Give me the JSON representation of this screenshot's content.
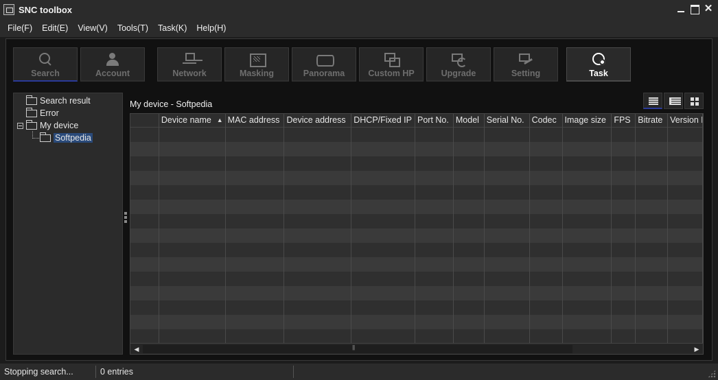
{
  "window": {
    "title": "SNC toolbox"
  },
  "menu": [
    "File(F)",
    "Edit(E)",
    "View(V)",
    "Tools(T)",
    "Task(K)",
    "Help(H)"
  ],
  "toolbar": {
    "search": "Search",
    "account": "Account",
    "network": "Network",
    "masking": "Masking",
    "panorama": "Panorama",
    "custom_hp": "Custom HP",
    "upgrade": "Upgrade",
    "setting": "Setting",
    "task": "Task"
  },
  "tree": {
    "search_result": "Search result",
    "error": "Error",
    "my_device": "My device",
    "softpedia": "Softpedia"
  },
  "pane": {
    "header": "My device - Softpedia"
  },
  "grid": {
    "columns": [
      "",
      "Device name",
      "MAC address",
      "Device address",
      "DHCP/Fixed IP",
      "Port No.",
      "Model",
      "Serial No.",
      "Codec",
      "Image size",
      "FPS",
      "Bitrate",
      "Version N"
    ],
    "sort_indicator": "▲"
  },
  "status": {
    "message": "Stopping search...",
    "entries": "0 entries"
  }
}
